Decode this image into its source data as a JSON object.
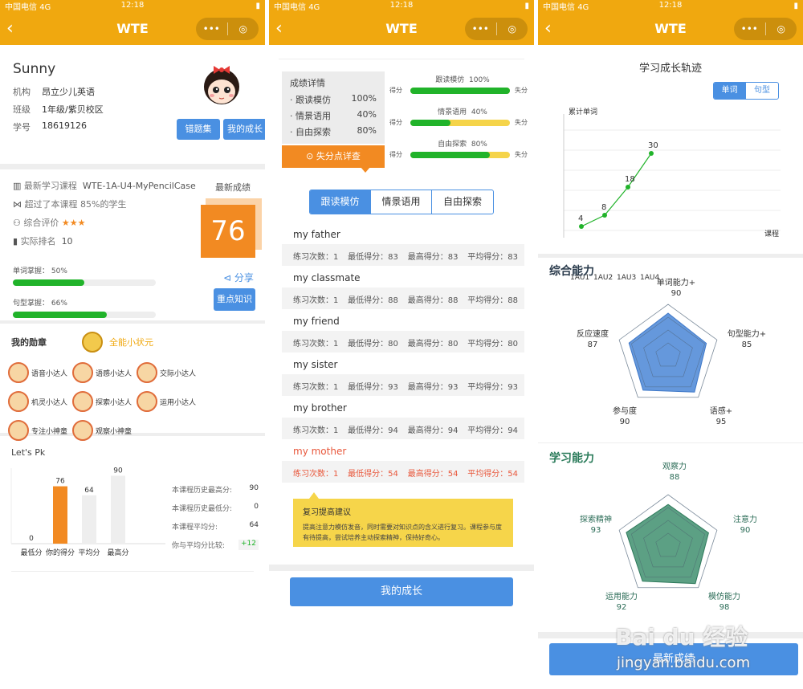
{
  "status": {
    "carrier": "中国电信",
    "net": "4G",
    "time": "12:18"
  },
  "nav": {
    "title": "WTE",
    "back_icon": "‹",
    "more_icon": "•••",
    "record_icon": "◎"
  },
  "p1": {
    "name": "Sunny",
    "info": [
      {
        "k": "机构",
        "v": "昂立少儿英语"
      },
      {
        "k": "班级",
        "v": "1年级/紫贝校区"
      },
      {
        "k": "学号",
        "v": "18619126"
      }
    ],
    "btn_mistakes": "错题集",
    "btn_growth": "我的成长",
    "course_label": "最新学习课程",
    "course_value": "WTE-1A-U4-MyPencilCase",
    "exceed_text": "超过了本课程 85%的学生",
    "rating_label": "综合评价",
    "stars": "★★★",
    "rank_label": "实际排名",
    "rank_value": "10",
    "score_label": "最新成绩",
    "score_value": "76",
    "share_label": "分享",
    "word_label": "单词掌握：",
    "word_value": "50%",
    "word_fraction": 0.5,
    "sentence_label": "句型掌握：",
    "sentence_value": "66%",
    "sentence_fraction": 0.66,
    "btn_key": "重点知识",
    "medals_title": "我的勋章",
    "top_medal": "全能小状元",
    "medals": [
      "语音小达人",
      "语感小达人",
      "交际小达人",
      "机灵小达人",
      "探索小达人",
      "运用小达人",
      "专注小神童",
      "观察小神童"
    ],
    "pk_title": "Let's Pk",
    "pk_stats": [
      {
        "k": "本课程历史最高分:",
        "v": "90"
      },
      {
        "k": "本课程历史最低分:",
        "v": "0"
      },
      {
        "k": "本课程平均分:",
        "v": "64"
      },
      {
        "k": "你与平均分比较:",
        "v": "+12"
      }
    ]
  },
  "chart_data": [
    {
      "type": "bar",
      "categories": [
        "最低分",
        "你的得分",
        "平均分",
        "最高分"
      ],
      "values": [
        0,
        76,
        64,
        90
      ],
      "ylim": [
        0,
        100
      ]
    },
    {
      "type": "line",
      "title": "学习成长轨迹",
      "ylabel": "累计单词",
      "xlabel": "课程",
      "categories": [
        "1AU1",
        "1AU2",
        "1AU3",
        "1AU4"
      ],
      "values": [
        4,
        8,
        18,
        30
      ]
    }
  ],
  "p2": {
    "detail_title": "成绩详情",
    "details": [
      {
        "k": "· 跟读模仿",
        "v": "100%"
      },
      {
        "k": "· 情景语用",
        "v": "40%"
      },
      {
        "k": "· 自由探索",
        "v": "80%"
      }
    ],
    "loss_btn": "失分点详查",
    "bars": [
      {
        "name": "跟读模仿",
        "pct": "100%",
        "frac": 1.0
      },
      {
        "name": "情景语用",
        "pct": "40%",
        "frac": 0.4
      },
      {
        "name": "自由探索",
        "pct": "80%",
        "frac": 0.8
      }
    ],
    "get_label": "得分",
    "lose_label": "失分",
    "tabs": [
      "跟读模仿",
      "情景语用",
      "自由探索"
    ],
    "words": [
      {
        "w": "my father",
        "n": "1",
        "min": "83",
        "max": "83",
        "avg": "83"
      },
      {
        "w": "my classmate",
        "n": "1",
        "min": "88",
        "max": "88",
        "avg": "88"
      },
      {
        "w": "my friend",
        "n": "1",
        "min": "80",
        "max": "80",
        "avg": "80"
      },
      {
        "w": "my sister",
        "n": "1",
        "min": "93",
        "max": "93",
        "avg": "93"
      },
      {
        "w": "my brother",
        "n": "1",
        "min": "94",
        "max": "94",
        "avg": "94"
      },
      {
        "w": "my mother",
        "n": "1",
        "min": "54",
        "max": "54",
        "avg": "54"
      }
    ],
    "stat_n": "练习次数：",
    "stat_min": "最低得分：",
    "stat_max": "最高得分：",
    "stat_avg": "平均得分：",
    "advice_title": "复习提高建议",
    "advice_text": "提高注意力模仿发音，同时需要对知识点的含义进行复习。课程参与度有待提高，尝试培养主动探索精神，保持好奇心。",
    "growth_btn": "我的成长"
  },
  "p3": {
    "toggle": [
      "单词",
      "句型"
    ],
    "radar1_title": "综合能力",
    "radar1": [
      {
        "k": "单词能力+",
        "v": "90"
      },
      {
        "k": "句型能力+",
        "v": "85"
      },
      {
        "k": "语感+",
        "v": "95"
      },
      {
        "k": "参与度",
        "v": "90"
      },
      {
        "k": "反应速度",
        "v": "87"
      }
    ],
    "radar2_title": "学习能力",
    "radar2": [
      {
        "k": "观察力",
        "v": "88"
      },
      {
        "k": "注意力",
        "v": "90"
      },
      {
        "k": "模仿能力",
        "v": "98"
      },
      {
        "k": "运用能力",
        "v": "92"
      },
      {
        "k": "探索精神",
        "v": "93"
      }
    ],
    "bottom_btn": "最新成绩",
    "watermark": "Bai du 经验",
    "watermark_url": "jingyan.baidu.com"
  },
  "colors": {
    "brand": "#f0a80f",
    "blue": "#4a90e2",
    "green": "#21b32a",
    "orange": "#f28a22"
  }
}
